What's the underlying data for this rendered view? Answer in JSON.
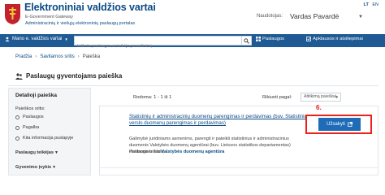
{
  "header": {
    "title": "Elektroniniai valdžios vartai",
    "subtitle_en": "E-Government Gateway",
    "tagline": "Administracinių ir viešųjų elektroninių paslaugų portalas",
    "lang_lt": "LT",
    "lang_en": "EN",
    "user_label": "Naudotojas:",
    "user_name": "Vardas Pavardė"
  },
  "nav": {
    "my_gov": "Mano e. valdžios vartai",
    "search_placeholder": "Ieškote paslaugos ar teikėjo pavadinimą",
    "services": "Paslaugos",
    "payments": "Apklausos ir atsiliepimai"
  },
  "breadcrumb": [
    "Pradžia",
    "Savitarnos sritis",
    "Paieška"
  ],
  "page": {
    "title": "Paslaugų gyventojams paieška"
  },
  "filter": {
    "heading": "Detalioji paieška",
    "service_type_label": "Paieškos sritis:",
    "options": [
      "Paslaugos",
      "Pagalba",
      "Kita informacija puslapyje"
    ],
    "provider_section": "Paslaugų teikėjas",
    "life_event_section": "Gyvenimo įvykis"
  },
  "results": {
    "count_text": "Rodoma: 1 - 1 iš 1",
    "sort_label": "Rikiuoti pagal:",
    "sort_value": "Atitikimą paieškai",
    "item": {
      "title": "Statistinių ir administracinių duomenų parengimas ir perdavimas (buv. Statistinių verslo duomenų parengimas ir perdavimas)",
      "description": "Galimybė juridiniams asmenims, parengti ir pateikti statistinius ir administracinius duomenis Valstybės duomenų agentūrai (buv. Lietuvos statistikos departamentas) elektroniniu būdu,...",
      "provider_prefix": "Paslauga teikia",
      "provider_name": "Valstybės duomenų agentūra",
      "order_button": "Užsakyti"
    },
    "step_marker": "6."
  },
  "colors": {
    "brand_blue": "#0b4a84",
    "nav_blue": "#1f5a94",
    "button_blue": "#1e6bb8",
    "highlight_red": "#e8231b"
  }
}
